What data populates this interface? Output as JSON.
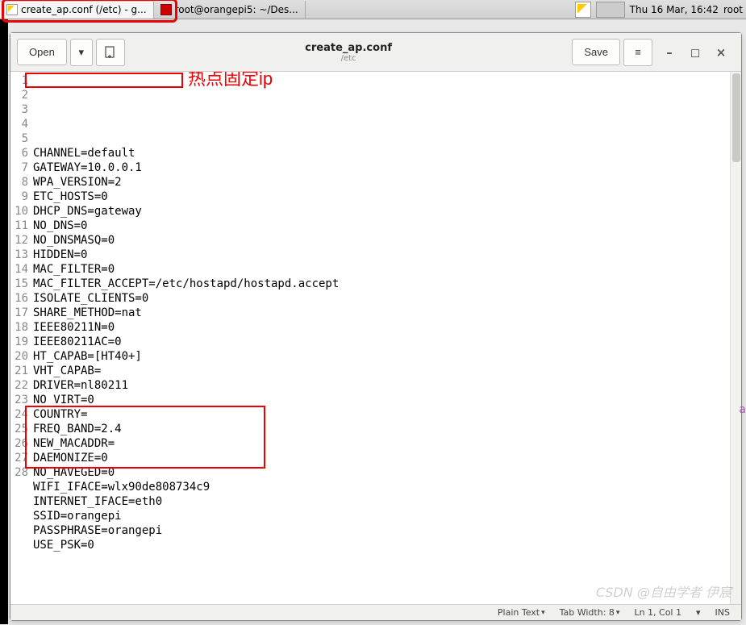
{
  "taskbar": {
    "items": [
      {
        "label": "create_ap.conf (/etc) - g..."
      },
      {
        "label": "root@orangepi5: ~/Des..."
      }
    ],
    "clock": "Thu 16 Mar, 16:42",
    "user": "root"
  },
  "toolbar": {
    "open_label": "Open",
    "dropdown_glyph": "▾",
    "newdoc_glyph": "⬚",
    "save_label": "Save",
    "menu_glyph": "≡"
  },
  "title": {
    "filename": "create_ap.conf",
    "path": "/etc"
  },
  "window_controls": {
    "minimize": "–",
    "maximize": "◻",
    "close": "×"
  },
  "lines": [
    "CHANNEL=default",
    "GATEWAY=10.0.0.1",
    "WPA_VERSION=2",
    "ETC_HOSTS=0",
    "DHCP_DNS=gateway",
    "NO_DNS=0",
    "NO_DNSMASQ=0",
    "HIDDEN=0",
    "MAC_FILTER=0",
    "MAC_FILTER_ACCEPT=/etc/hostapd/hostapd.accept",
    "ISOLATE_CLIENTS=0",
    "SHARE_METHOD=nat",
    "IEEE80211N=0",
    "IEEE80211AC=0",
    "HT_CAPAB=[HT40+]",
    "VHT_CAPAB=",
    "DRIVER=nl80211",
    "NO_VIRT=0",
    "COUNTRY=",
    "FREQ_BAND=2.4",
    "NEW_MACADDR=",
    "DAEMONIZE=0",
    "NO_HAVEGED=0",
    "WIFI_IFACE=wlx90de808734c9",
    "INTERNET_IFACE=eth0",
    "SSID=orangepi",
    "PASSPHRASE=orangepi",
    "USE_PSK=0"
  ],
  "annotation": {
    "text": "热点固定ip"
  },
  "statusbar": {
    "syntax": "Plain Text",
    "tabwidth": "Tab Width: 8",
    "position": "Ln 1, Col 1",
    "ovr": "▾",
    "ins": "INS"
  },
  "watermark": "CSDN @自由学者 伊宸"
}
